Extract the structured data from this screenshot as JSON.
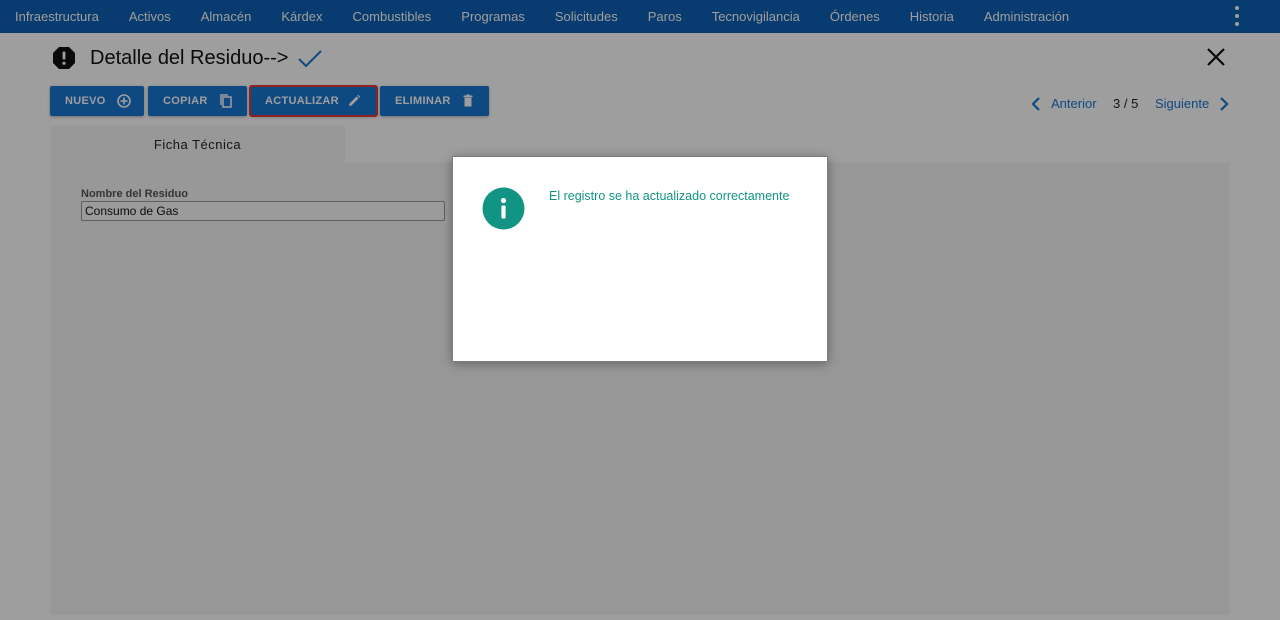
{
  "nav": {
    "items": [
      "Infraestructura",
      "Activos",
      "Almacén",
      "Kárdex",
      "Combustibles",
      "Programas",
      "Solicitudes",
      "Paros",
      "Tecnovigilancia",
      "Órdenes",
      "Historia",
      "Administración"
    ],
    "menu_icon": "kebab-menu-icon"
  },
  "header": {
    "title": "Detalle del Residuo-->",
    "status_icon": "alert-octagon-icon",
    "saved_icon": "check-icon",
    "close_icon": "close-icon"
  },
  "toolbar": {
    "nuevo_label": "NUEVO",
    "copiar_label": "COPIAR",
    "actualizar_label": "ACTUALIZAR",
    "eliminar_label": "ELIMINAR"
  },
  "pager": {
    "prev_label": "Anterior",
    "count": "3 / 5",
    "next_label": "Siguiente"
  },
  "tabs": [
    {
      "label": "Ficha Técnica"
    }
  ],
  "form": {
    "nombre_label": "Nombre del Residuo",
    "nombre_value": "Consumo de Gas"
  },
  "modal": {
    "icon": "info-icon",
    "message": "El registro se ha actualizado correctamente"
  },
  "colors": {
    "nav_bg": "#0d5fb3",
    "button_bg": "#1976d2",
    "highlight": "#e53935",
    "info_accent": "#129484"
  }
}
